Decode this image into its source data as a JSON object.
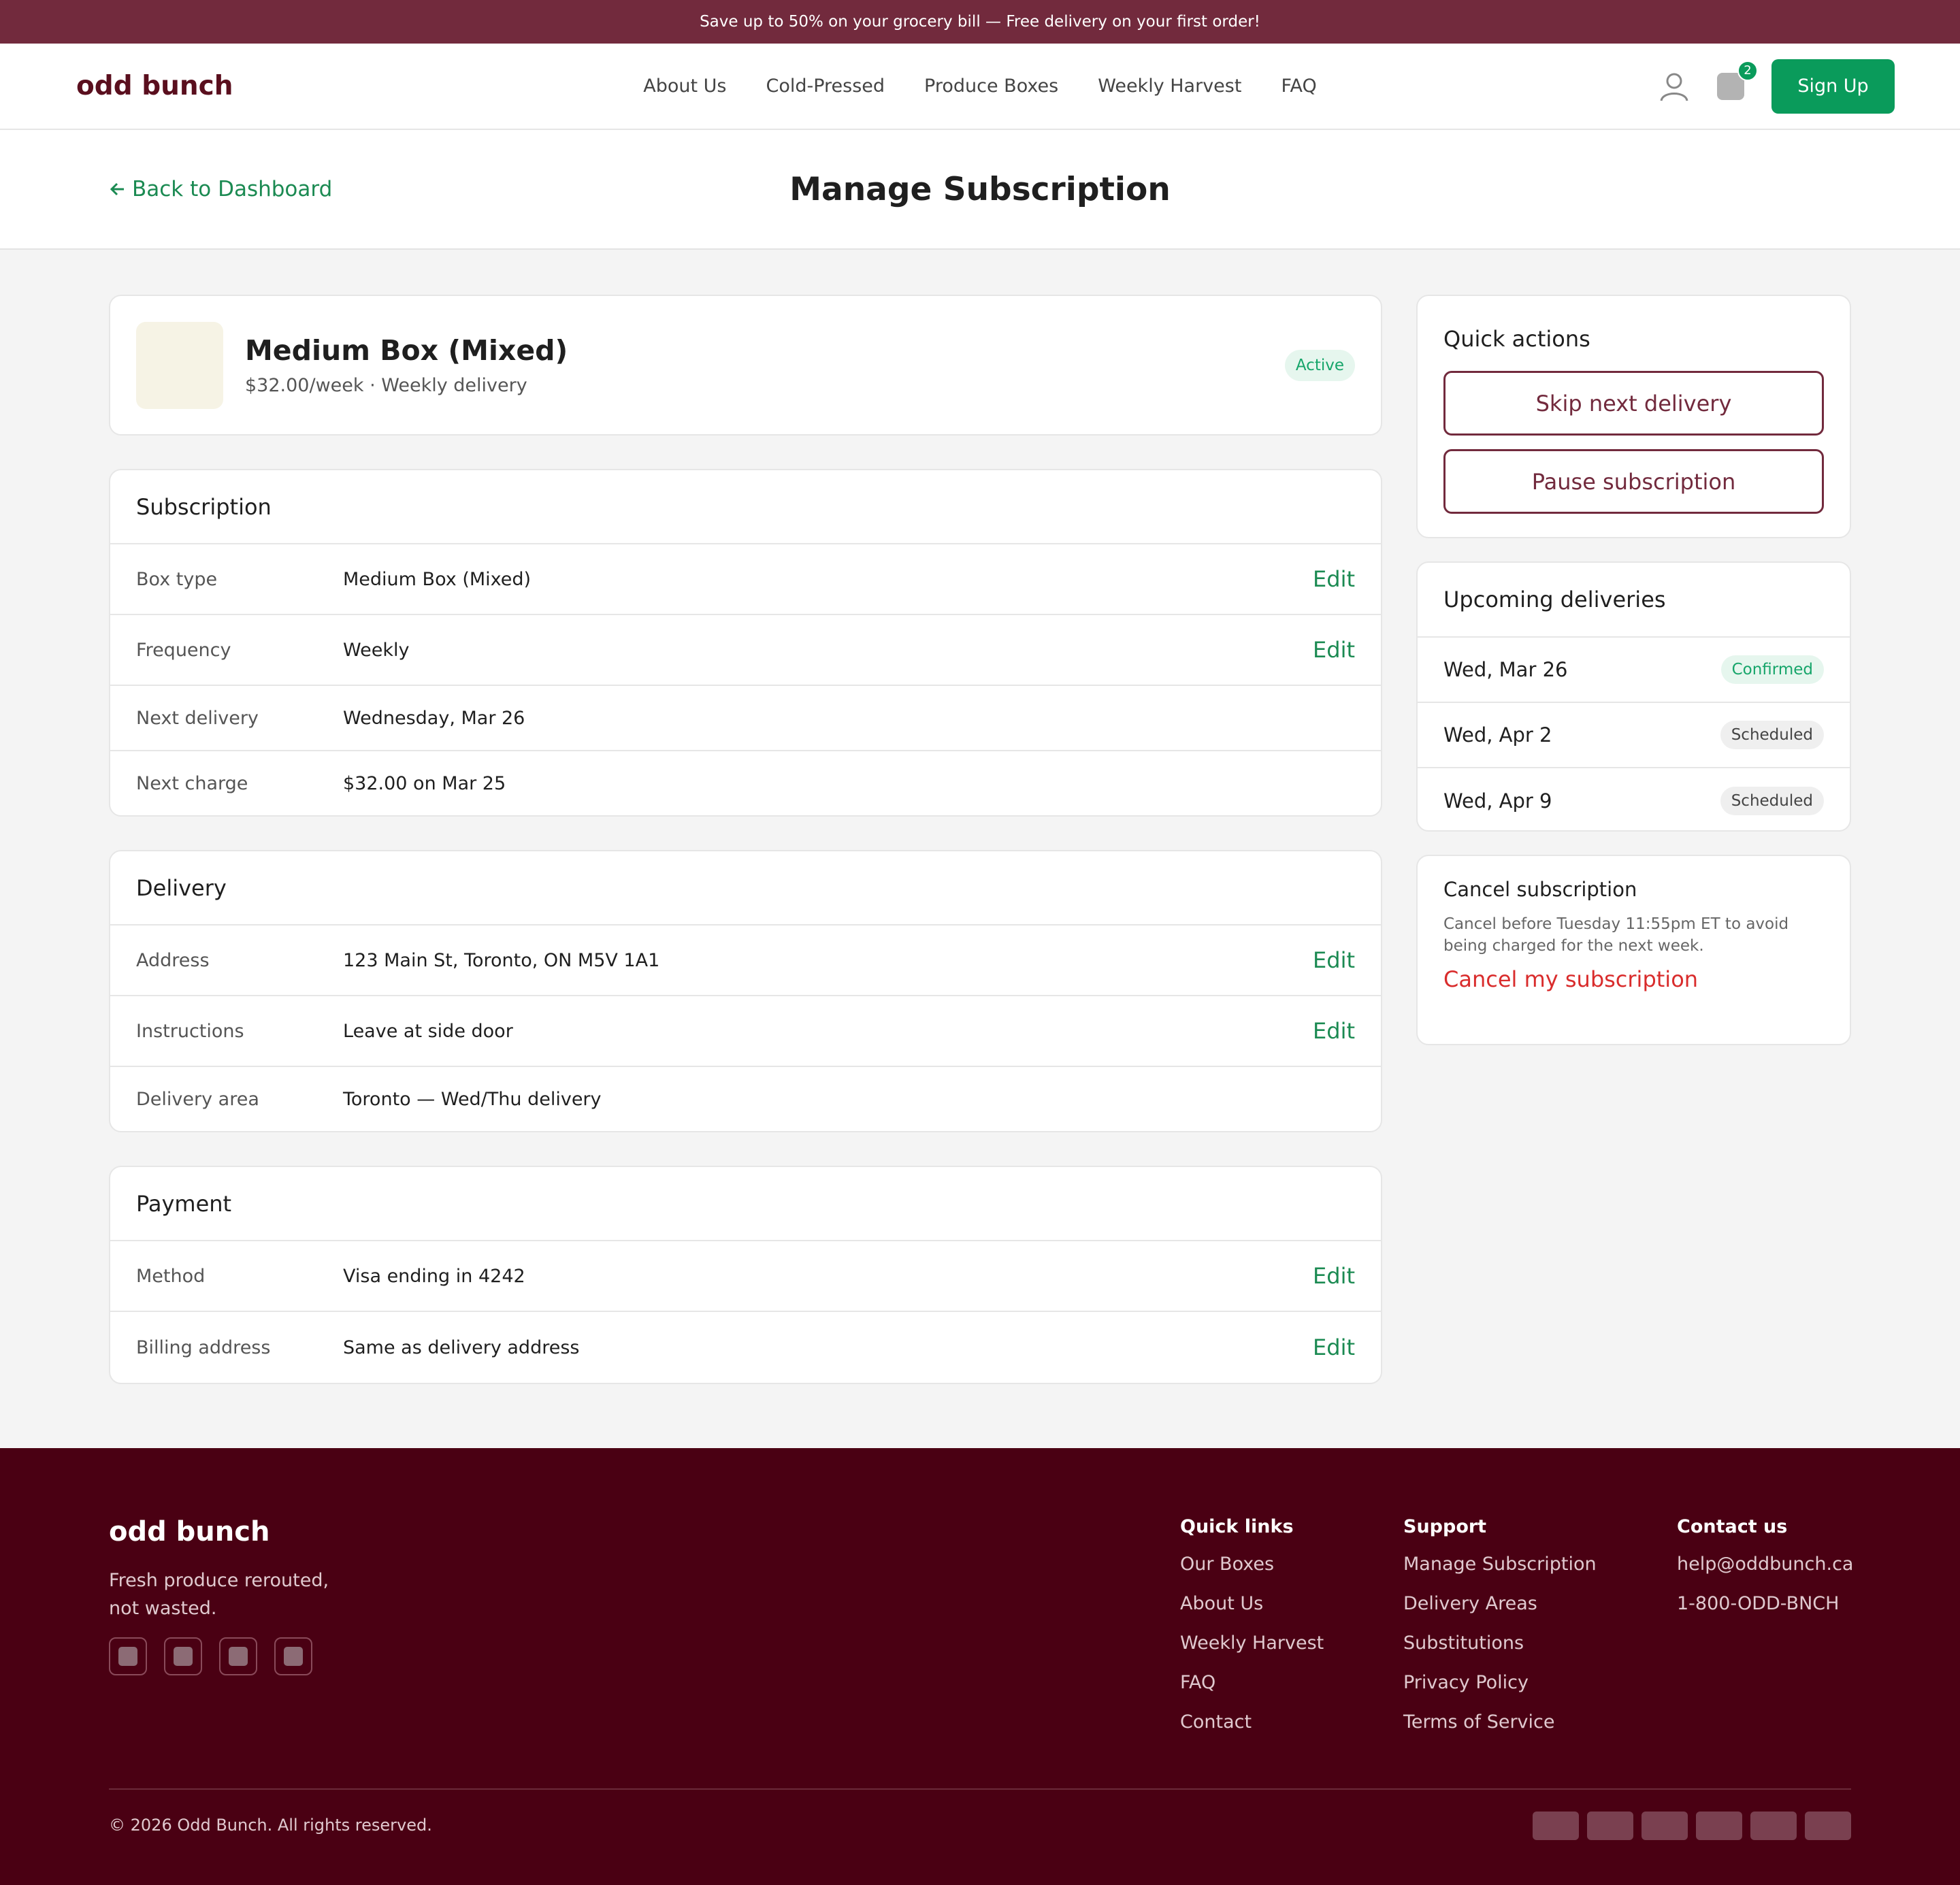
{
  "promo": {
    "text": "Save up to 50% on your grocery bill — Free delivery on your first order!"
  },
  "nav": {
    "logo": "odd bunch",
    "links": [
      "About Us",
      "Cold-Pressed",
      "Produce Boxes",
      "Weekly Harvest",
      "FAQ"
    ],
    "cart_count": "2",
    "signup": "Sign Up"
  },
  "page": {
    "back": "Back to Dashboard",
    "title": "Manage Subscription"
  },
  "product": {
    "name": "Medium Box (Mixed)",
    "meta": "$32.00/week · Weekly delivery",
    "status": "Active"
  },
  "subscription": {
    "title": "Subscription",
    "rows": [
      {
        "label": "Box type",
        "value": "Medium Box (Mixed)",
        "edit": "Edit"
      },
      {
        "label": "Frequency",
        "value": "Weekly",
        "edit": "Edit"
      },
      {
        "label": "Next delivery",
        "value": "Wednesday, Mar 26"
      },
      {
        "label": "Next charge",
        "value": "$32.00 on Mar 25"
      }
    ]
  },
  "delivery": {
    "title": "Delivery",
    "rows": [
      {
        "label": "Address",
        "value": "123 Main St, Toronto, ON M5V 1A1",
        "edit": "Edit"
      },
      {
        "label": "Instructions",
        "value": "Leave at side door",
        "edit": "Edit"
      },
      {
        "label": "Delivery area",
        "value": "Toronto — Wed/Thu delivery"
      }
    ]
  },
  "payment": {
    "title": "Payment",
    "rows": [
      {
        "label": "Method",
        "value": "Visa ending in 4242",
        "edit": "Edit"
      },
      {
        "label": "Billing address",
        "value": "Same as delivery address",
        "edit": "Edit"
      }
    ]
  },
  "quick_actions": {
    "title": "Quick actions",
    "skip": "Skip next delivery",
    "pause": "Pause subscription"
  },
  "upcoming": {
    "title": "Upcoming deliveries",
    "items": [
      {
        "date": "Wed, Mar 26",
        "status": "Confirmed"
      },
      {
        "date": "Wed, Apr 2",
        "status": "Scheduled"
      },
      {
        "date": "Wed, Apr 9",
        "status": "Scheduled"
      }
    ]
  },
  "cancel": {
    "title": "Cancel subscription",
    "note": "Cancel before Tuesday 11:55pm ET to avoid being charged for the next week.",
    "link": "Cancel my subscription"
  },
  "footer": {
    "logo": "odd bunch",
    "tagline": "Fresh produce rerouted, not wasted.",
    "quick_links": {
      "title": "Quick links",
      "items": [
        "Our Boxes",
        "About Us",
        "Weekly Harvest",
        "FAQ",
        "Contact"
      ]
    },
    "support": {
      "title": "Support",
      "items": [
        "Manage Subscription",
        "Delivery Areas",
        "Substitutions",
        "Privacy Policy",
        "Terms of Service"
      ]
    },
    "contact": {
      "title": "Contact us",
      "items": [
        "help@oddbunch.ca",
        "1-800-ODD-BNCH"
      ]
    },
    "copyright": "© 2026 Odd Bunch. All rights reserved."
  },
  "colors": {
    "brand": "#722a3d",
    "accent": "#0a9b5b",
    "footer_bg": "#4a0013",
    "danger": "#d92c2c"
  }
}
